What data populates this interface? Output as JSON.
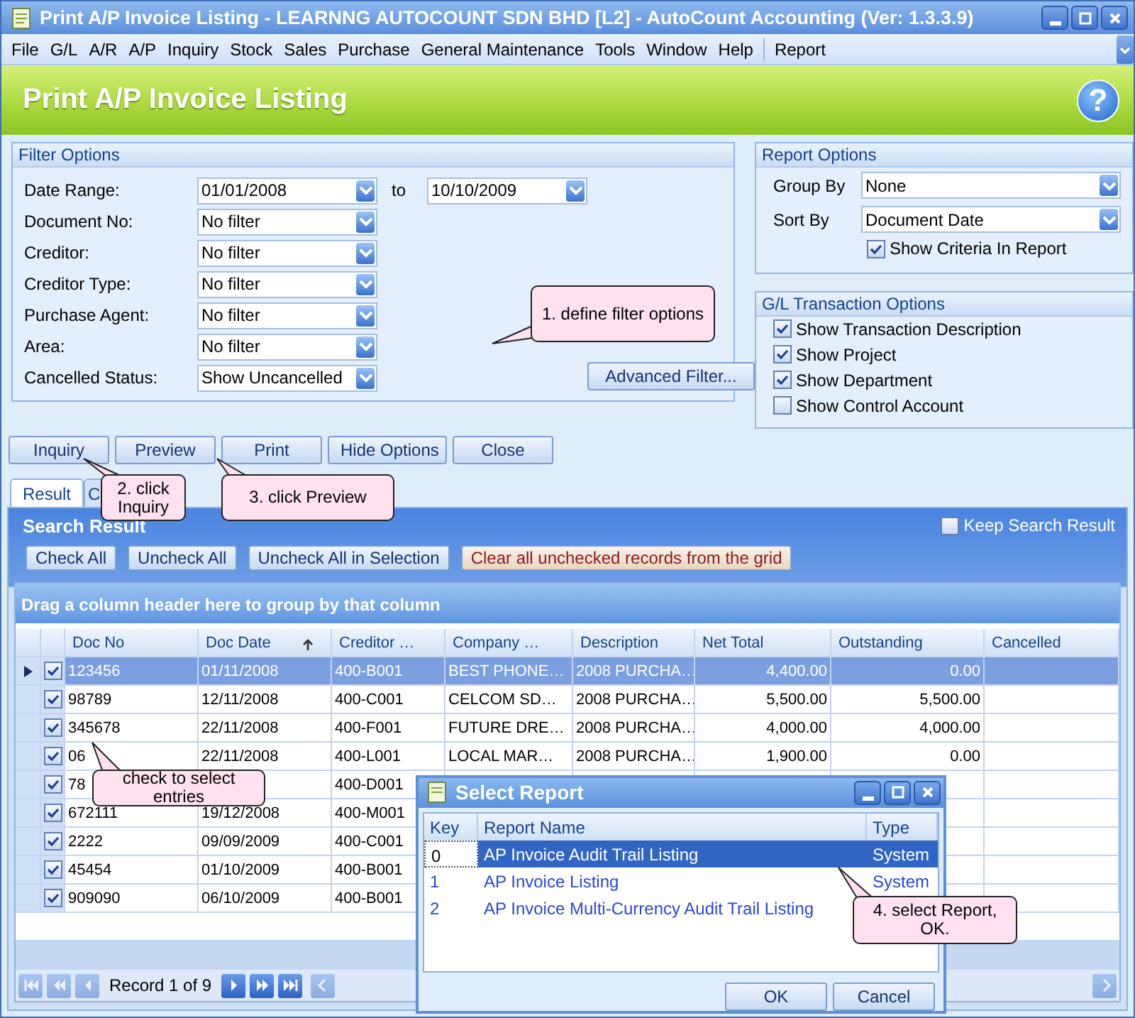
{
  "window": {
    "title": "Print A/P Invoice Listing - LEARNNG AUTOCOUNT SDN BHD [L2] - AutoCount Accounting (Ver: 1.3.3.9)"
  },
  "menu": [
    "File",
    "G/L",
    "A/R",
    "A/P",
    "Inquiry",
    "Stock",
    "Sales",
    "Purchase",
    "General Maintenance",
    "Tools",
    "Window",
    "Help",
    "Report"
  ],
  "header": {
    "title": "Print A/P Invoice Listing",
    "help": "?"
  },
  "filter_options": {
    "title": "Filter Options",
    "fields": [
      {
        "label": "Date Range:",
        "value": "01/01/2008",
        "to_label": "to",
        "to_value": "10/10/2009"
      },
      {
        "label": "Document No:",
        "value": "No filter"
      },
      {
        "label": "Creditor:",
        "value": "No filter"
      },
      {
        "label": "Creditor Type:",
        "value": "No filter"
      },
      {
        "label": "Purchase Agent:",
        "value": "No filter"
      },
      {
        "label": "Area:",
        "value": "No filter"
      },
      {
        "label": "Cancelled Status:",
        "value": "Show Uncancelled"
      }
    ],
    "advanced_button": "Advanced Filter..."
  },
  "report_options": {
    "title": "Report Options",
    "fields": [
      {
        "label": "Group By",
        "value": "None"
      },
      {
        "label": "Sort By",
        "value": "Document Date"
      }
    ],
    "show_criteria": {
      "label": "Show Criteria In Report",
      "checked": true
    }
  },
  "gl_options": {
    "title": "G/L Transaction Options",
    "items": [
      {
        "label": "Show Transaction Description",
        "checked": true
      },
      {
        "label": "Show Project",
        "checked": true
      },
      {
        "label": "Show Department",
        "checked": true
      },
      {
        "label": "Show Control Account",
        "checked": false
      }
    ]
  },
  "actions": [
    "Inquiry",
    "Preview",
    "Print",
    "Hide Options",
    "Close"
  ],
  "tabs": [
    {
      "label": "Result",
      "selected": true
    },
    {
      "label": "C",
      "selected": false
    }
  ],
  "search_result": {
    "title": "Search Result",
    "keep": {
      "label": "Keep Search Result",
      "checked": false
    },
    "buttons": [
      {
        "label": "Check All",
        "kind": "normal"
      },
      {
        "label": "Uncheck All",
        "kind": "normal"
      },
      {
        "label": "Uncheck All in Selection",
        "kind": "normal"
      },
      {
        "label": "Clear all unchecked records from the grid",
        "kind": "warning"
      }
    ],
    "group_hint": "Drag a column header here to group by that column"
  },
  "table": {
    "columns": [
      {
        "label": "Doc No",
        "sorted": false,
        "kind": "text"
      },
      {
        "label": "Doc Date",
        "sorted": true,
        "kind": "text"
      },
      {
        "label": "Creditor …",
        "sorted": false,
        "kind": "text"
      },
      {
        "label": "Company …",
        "sorted": false,
        "kind": "text"
      },
      {
        "label": "Description",
        "sorted": false,
        "kind": "text"
      },
      {
        "label": "Net Total",
        "sorted": false,
        "kind": "number"
      },
      {
        "label": "Outstanding",
        "sorted": false,
        "kind": "number"
      },
      {
        "label": "Cancelled",
        "sorted": false
      }
    ],
    "rows": [
      {
        "selected": true,
        "checked": true,
        "cells": [
          "123456",
          "01/11/2008",
          "400-B001",
          "BEST PHONE…",
          "2008 PURCHA…",
          "4,400.00",
          "0.00",
          null
        ]
      },
      {
        "selected": false,
        "checked": true,
        "cells": [
          "98789",
          "12/11/2008",
          "400-C001",
          "CELCOM SD…",
          "2008 PURCHA…",
          "5,500.00",
          "5,500.00",
          null
        ]
      },
      {
        "selected": false,
        "checked": true,
        "cells": [
          "345678",
          "22/11/2008",
          "400-F001",
          "FUTURE DRE…",
          "2008 PURCHA…",
          "4,000.00",
          "4,000.00",
          null
        ]
      },
      {
        "selected": false,
        "checked": true,
        "cells": [
          "06",
          "22/11/2008",
          "400-L001",
          "LOCAL MAR…",
          "2008 PURCHA…",
          "1,900.00",
          "0.00",
          null
        ]
      },
      {
        "selected": false,
        "checked": true,
        "cells": [
          "78",
          null,
          "400-D001",
          null,
          null,
          null,
          null,
          null
        ]
      },
      {
        "selected": false,
        "checked": true,
        "cells": [
          "672111",
          "19/12/2008",
          "400-M001",
          null,
          null,
          null,
          null,
          null
        ]
      },
      {
        "selected": false,
        "checked": true,
        "cells": [
          "2222",
          "09/09/2009",
          "400-C001",
          null,
          null,
          null,
          null,
          null
        ]
      },
      {
        "selected": false,
        "checked": true,
        "cells": [
          "45454",
          "01/10/2009",
          "400-B001",
          null,
          null,
          null,
          null,
          null
        ]
      },
      {
        "selected": false,
        "checked": true,
        "cells": [
          "909090",
          "06/10/2009",
          "400-B001",
          null,
          null,
          null,
          null,
          null
        ]
      }
    ]
  },
  "pager": {
    "record": "Record 1 of 9"
  },
  "dialog": {
    "title": "Select Report",
    "columns": [
      "Key",
      "Report Name",
      "Type"
    ],
    "rows": [
      {
        "key": "0",
        "name": "AP Invoice Audit Trail Listing",
        "type": "System",
        "selected": true
      },
      {
        "key": "1",
        "name": "AP Invoice Listing",
        "type": "System",
        "selected": false
      },
      {
        "key": "2",
        "name": "AP Invoice Multi-Currency Audit Trail Listing",
        "selected": false
      }
    ],
    "buttons": [
      "OK",
      "Cancel"
    ]
  },
  "callouts": [
    "1. define filter options",
    "2. click Inquiry",
    "3. click Preview",
    "check to select entries",
    "4. select Report, OK."
  ]
}
